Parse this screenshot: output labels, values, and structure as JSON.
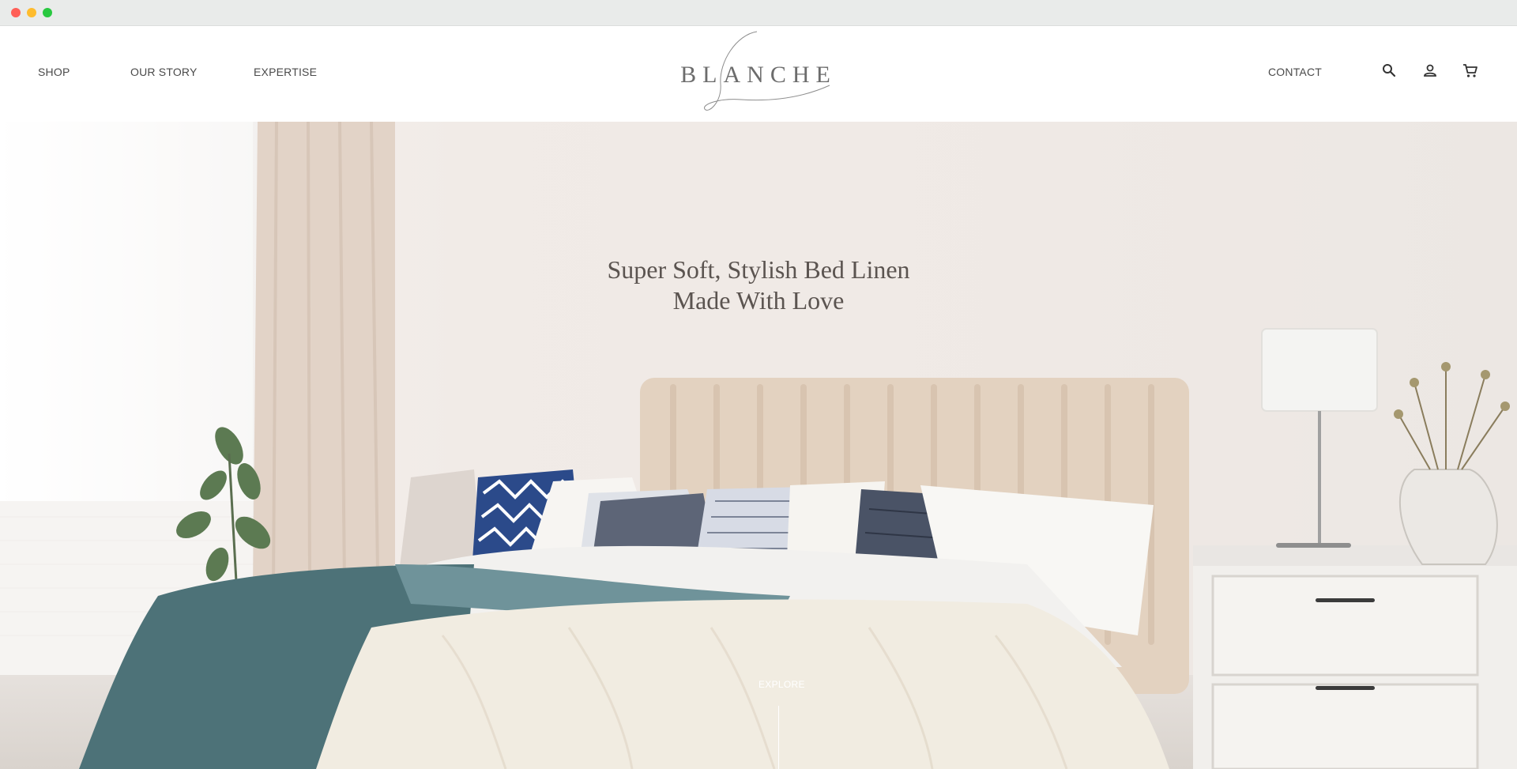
{
  "header": {
    "nav_left": [
      "SHOP",
      "OUR STORY",
      "EXPERTISE"
    ],
    "nav_right": [
      "CONTACT"
    ],
    "logo_text": "BLANCHE",
    "icons": [
      "search-icon",
      "account-icon",
      "cart-icon"
    ]
  },
  "hero": {
    "headline_line1": "Super Soft, Stylish Bed Linen",
    "headline_line2": "Made With Love",
    "cta_label": "EXPLORE"
  },
  "colors": {
    "text_dark": "#4a4a4a",
    "headline": "#5b5450",
    "headboard": "#e3d2c0",
    "curtain": "#e2d3c7",
    "throw_teal": "#4d7278",
    "throw_cream": "#f1ece1",
    "pillow_navy": "#2b4a8a"
  }
}
